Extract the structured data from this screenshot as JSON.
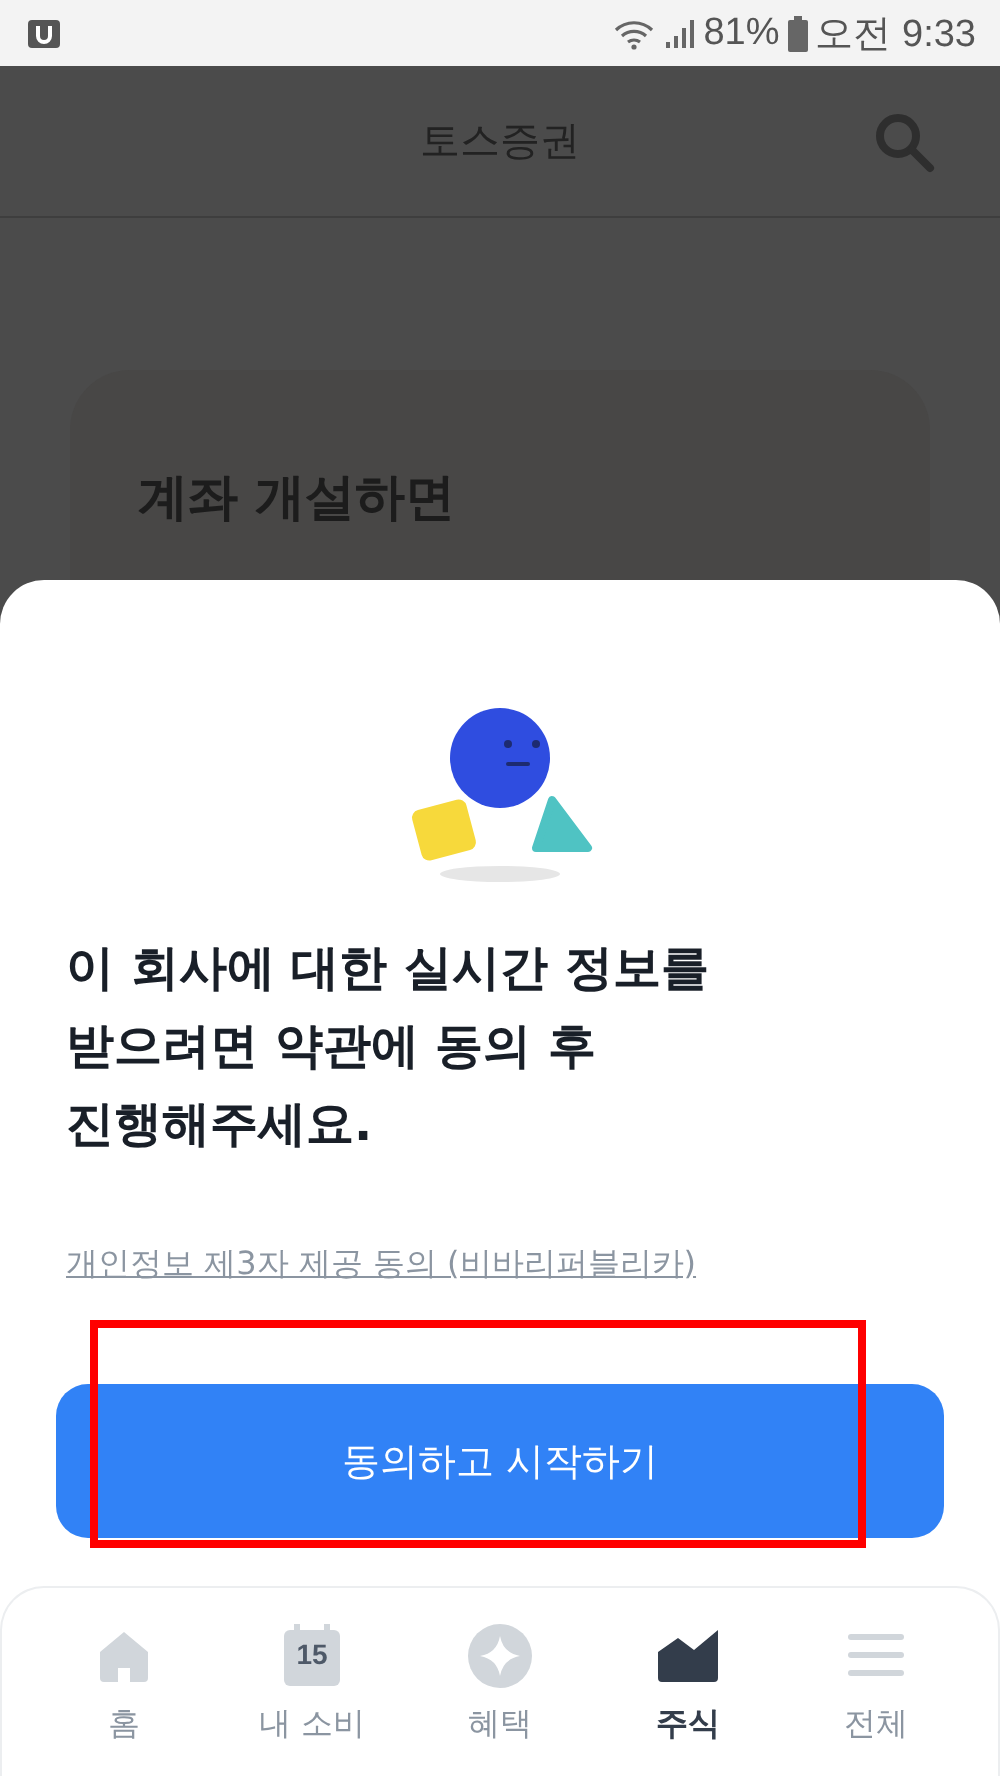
{
  "status_bar": {
    "battery": "81%",
    "time": "오전 9:33"
  },
  "header": {
    "title": "토스증권"
  },
  "background_card": {
    "lines": [
      "계좌 개설하면"
    ]
  },
  "sheet": {
    "message": "이 회사에 대한 실시간 정보를 받으려면 약관에 동의 후 진행해주세요.",
    "link": "개인정보 제3자 제공 동의 (비바리퍼블리카)",
    "button": {
      "label": "동의하고 시작하기",
      "highlighted": true
    }
  },
  "nav": [
    {
      "kind": "home",
      "label": "홈",
      "selected": false
    },
    {
      "kind": "calendar",
      "label": "내 소비",
      "icon_text": "15",
      "selected": false
    },
    {
      "kind": "sparkle",
      "label": "혜택",
      "selected": false
    },
    {
      "kind": "chart",
      "label": "주식",
      "selected": true
    },
    {
      "kind": "menu",
      "label": "전체",
      "selected": false
    }
  ]
}
